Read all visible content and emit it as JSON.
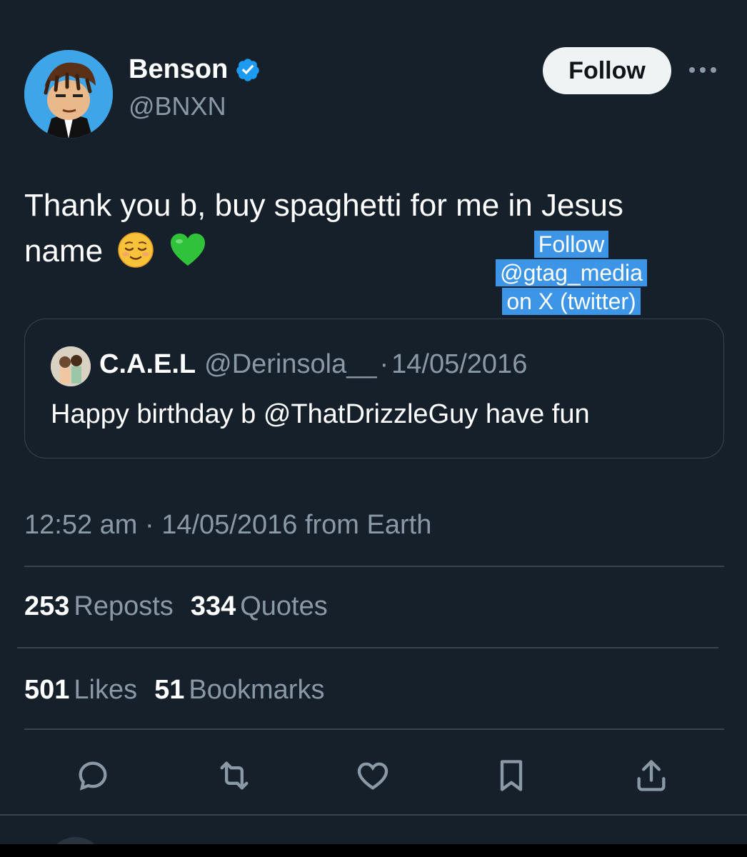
{
  "author": {
    "display_name": "Benson",
    "handle": "@BNXN",
    "verified": true
  },
  "header": {
    "follow_label": "Follow",
    "more_icon": "more-horizontal-icon"
  },
  "tweet": {
    "text_line1": "Thank you b, buy spaghetti for me in Jesus",
    "text_line2": "name",
    "emojis": [
      "relieved-face",
      "green-heart"
    ]
  },
  "watermark": {
    "line1": "Follow",
    "line2": "@gtag_media",
    "line3": "on X (twitter)"
  },
  "quote": {
    "display_name": "C.A.E.L",
    "handle": "@Derinsola__",
    "separator": "·",
    "date": "14/05/2016",
    "text": "Happy birthday b @ThatDrizzleGuy have fun"
  },
  "meta": {
    "timestamp": "12:52 am · 14/05/2016 from Earth"
  },
  "stats": {
    "reposts_count": "253",
    "reposts_label": "Reposts",
    "quotes_count": "334",
    "quotes_label": "Quotes",
    "likes_count": "501",
    "likes_label": "Likes",
    "bookmarks_count": "51",
    "bookmarks_label": "Bookmarks"
  },
  "actions": [
    "reply-icon",
    "repost-icon",
    "like-icon",
    "bookmark-icon",
    "share-icon"
  ],
  "colors": {
    "background": "#15202b",
    "secondary_text": "#8b98a5",
    "divider": "#38444d",
    "verified": "#1d9bf0",
    "watermark_bg": "#3c95e6"
  }
}
